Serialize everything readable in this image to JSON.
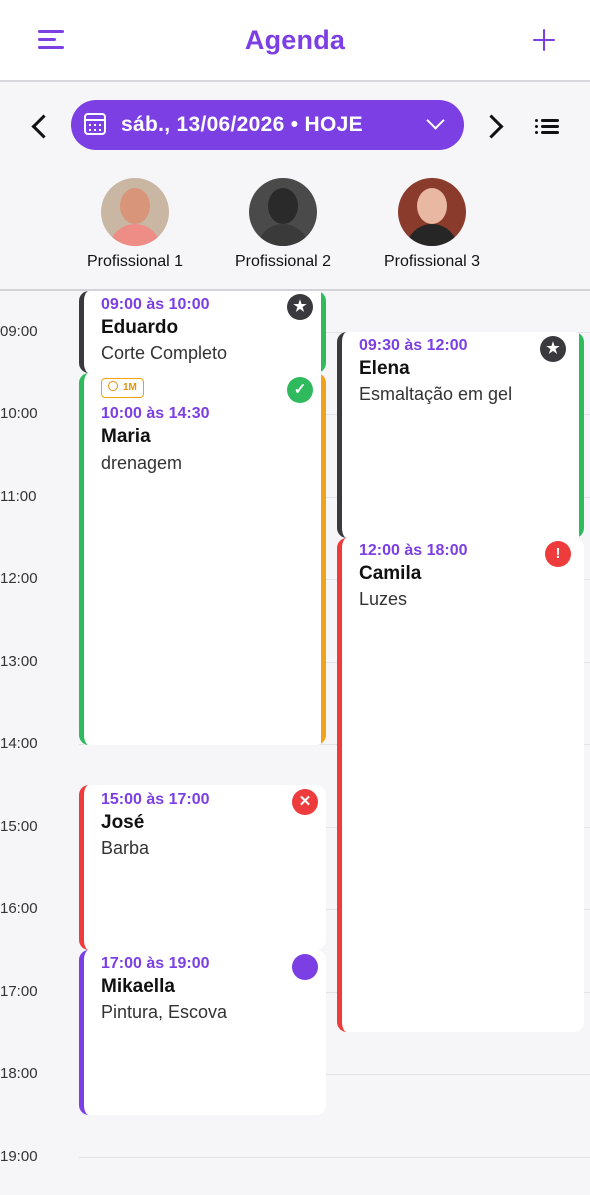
{
  "header": {
    "title": "Agenda"
  },
  "date_selector": {
    "label": "sáb., 13/06/2026 • HOJE"
  },
  "professionals": [
    {
      "name": "Profissional 1"
    },
    {
      "name": "Profissional 2"
    },
    {
      "name": "Profissional 3"
    }
  ],
  "hours": [
    "09:00",
    "10:00",
    "11:00",
    "12:00",
    "13:00",
    "14:00",
    "15:00",
    "16:00",
    "17:00",
    "18:00",
    "19:00"
  ],
  "appointments": [
    {
      "time": "09:00 às 10:00",
      "client": "Eduardo",
      "service": "Corte Completo",
      "status": "star",
      "status_icon": "star-icon"
    },
    {
      "time": "10:00 às 14:30",
      "client": "Maria",
      "service": "drenagem",
      "status": "confirmed",
      "status_icon": "check-icon",
      "tag": "1M"
    },
    {
      "time": "15:00 às 17:00",
      "client": "José",
      "service": "Barba",
      "status": "cancelled",
      "status_icon": "x-icon"
    },
    {
      "time": "17:00 às 19:00",
      "client": "Mikaella",
      "service": "Pintura, Escova",
      "status": "scheduled",
      "status_icon": "dot-icon"
    },
    {
      "time": "09:30 às 12:00",
      "client": "Elena",
      "service": "Esmaltação em gel",
      "status": "star",
      "status_icon": "star-icon"
    },
    {
      "time": "12:00 às 18:00",
      "client": "Camila",
      "service": "Luzes",
      "status": "alert",
      "status_icon": "exclamation-icon"
    }
  ],
  "colors": {
    "accent": "#7b3fe4",
    "green": "#2fba5e",
    "orange": "#f2a11b",
    "red": "#ee3b3b",
    "dark": "#3a3a3e"
  }
}
